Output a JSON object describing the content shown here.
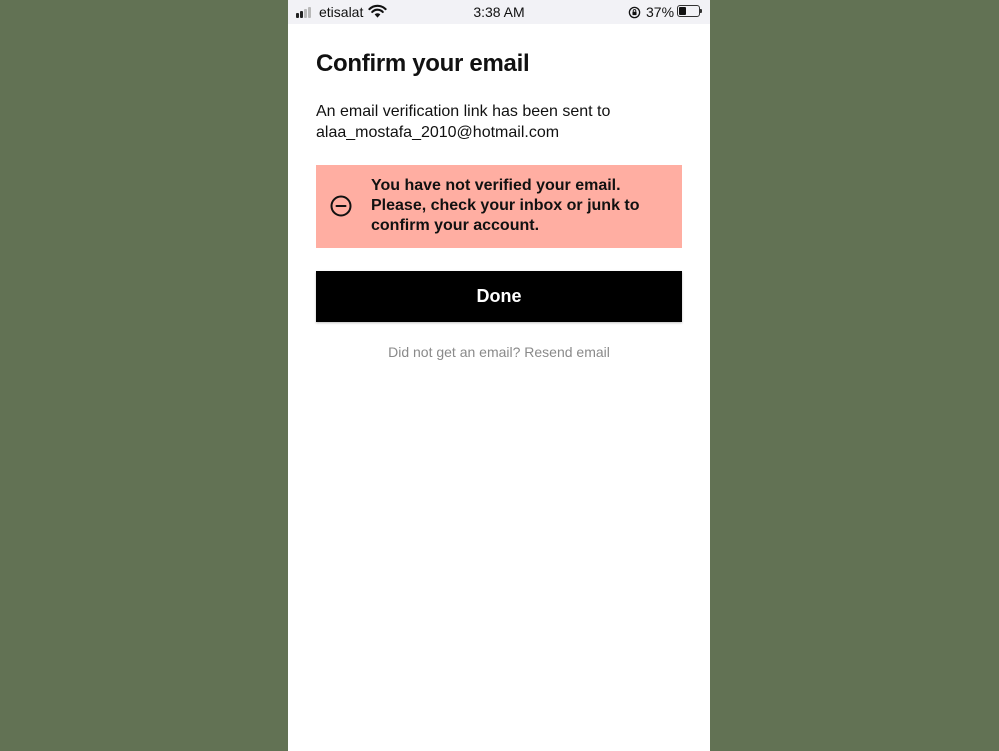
{
  "status_bar": {
    "carrier": "etisalat",
    "time": "3:38 AM",
    "battery_percent": "37%",
    "battery_level": 0.37,
    "signal_bars_active": 2,
    "icons": [
      "signal-icon",
      "wifi-icon",
      "orientation-lock-icon",
      "battery-icon"
    ]
  },
  "screen": {
    "title": "Confirm your email",
    "message_line1": "An email verification link has been sent to",
    "email": "alaa_mostafa_2010@hotmail.com",
    "alert": {
      "icon": "minus-circle-icon",
      "text": "You have not verified your email. Please, check your inbox or junk to confirm your account.",
      "background": "#ffaea2"
    },
    "done_label": "Done",
    "resend_text": "Did not get an email? Resend email"
  },
  "colors": {
    "backdrop": "#627254",
    "button": "#000000",
    "muted_text": "#8a8a8a"
  }
}
